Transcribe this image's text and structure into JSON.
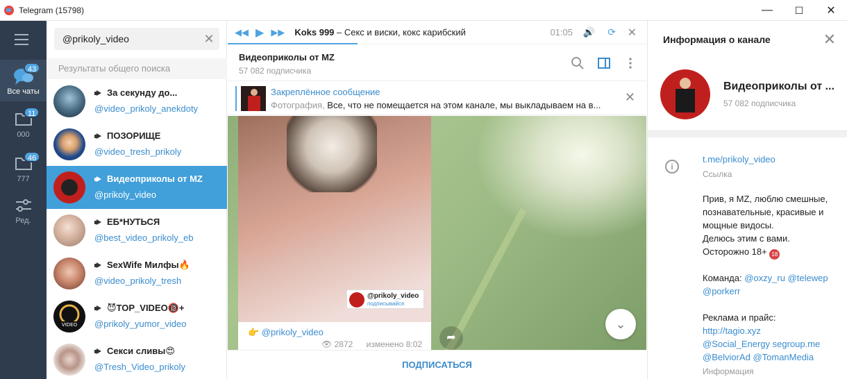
{
  "window": {
    "title": "Telegram (15798)",
    "minimize": "—",
    "maximize": "☐",
    "close": "✕"
  },
  "rail": {
    "menu_icon": "menu-icon",
    "items": [
      {
        "label": "Все чаты",
        "badge": "43"
      },
      {
        "label": "000",
        "badge": "11"
      },
      {
        "label": "777",
        "badge": "46"
      },
      {
        "label": "Ред.",
        "badge": ""
      }
    ]
  },
  "search": {
    "value": "@prikoly_video",
    "clear": "✕"
  },
  "results_header": "Результаты общего поиска",
  "results": [
    {
      "name": "За секунду до...",
      "username": "@video_prikoly_anekdoty"
    },
    {
      "name": "ПОЗОРИЩЕ",
      "username": "@video_tresh_prikoly"
    },
    {
      "name": "Видеоприколы от MZ",
      "username": "@prikoly_video"
    },
    {
      "name": "ЕБ*НУТЬСЯ",
      "username": "@best_video_prikoly_eb"
    },
    {
      "name": "SexWife Милфы🔥",
      "username": "@video_prikoly_tresh"
    },
    {
      "name": "😈TOP_VIDEO🔞+",
      "username": "@prikoly_yumor_video"
    },
    {
      "name": "Секси сливы😍",
      "username": "@Tresh_Video_prikoly"
    }
  ],
  "player": {
    "artist": "Koks 999",
    "title": " – Секс и виски, кокс карибский",
    "time": "01:05",
    "progress": 0.31
  },
  "chat": {
    "title": "Видеоприколы от MZ",
    "subtitle": "57 082 подписчика",
    "pinned_label": "Закреплённое сообщение",
    "pinned_prefix": "Фотография, ",
    "pinned_text": "Все, что не помещается на этом канале, мы выкладываем на в...",
    "watermark_name": "@prikoly_video",
    "watermark_sub": "подписывайся",
    "caption": "👉 @prikoly_video",
    "views": "2872",
    "edited": "изменено 8:02",
    "subscribe": "ПОДПИСАТЬСЯ"
  },
  "info": {
    "header": "Информация о канале",
    "name": "Видеоприколы от ...",
    "subscribers": "57 082 подписчика",
    "link": "t.me/prikoly_video",
    "link_label": "Ссылка",
    "desc": [
      "Прив, я MZ, люблю смешные,",
      "познавательные, красивые и",
      "мощные видосы.",
      "Делюсь этим с вами.",
      "Осторожно 18+"
    ],
    "badge18": "18",
    "team_label": "Команда: ",
    "team_links": [
      "@oxzy_ru",
      "@telewep",
      "@porkerr"
    ],
    "ads_label": "Реклама и прайс:",
    "ads_links": [
      "http://tagio.xyz",
      "@Social_Energy segroup.me",
      "@BelviorAd @TomanMedia"
    ],
    "info_label": "Информация"
  }
}
